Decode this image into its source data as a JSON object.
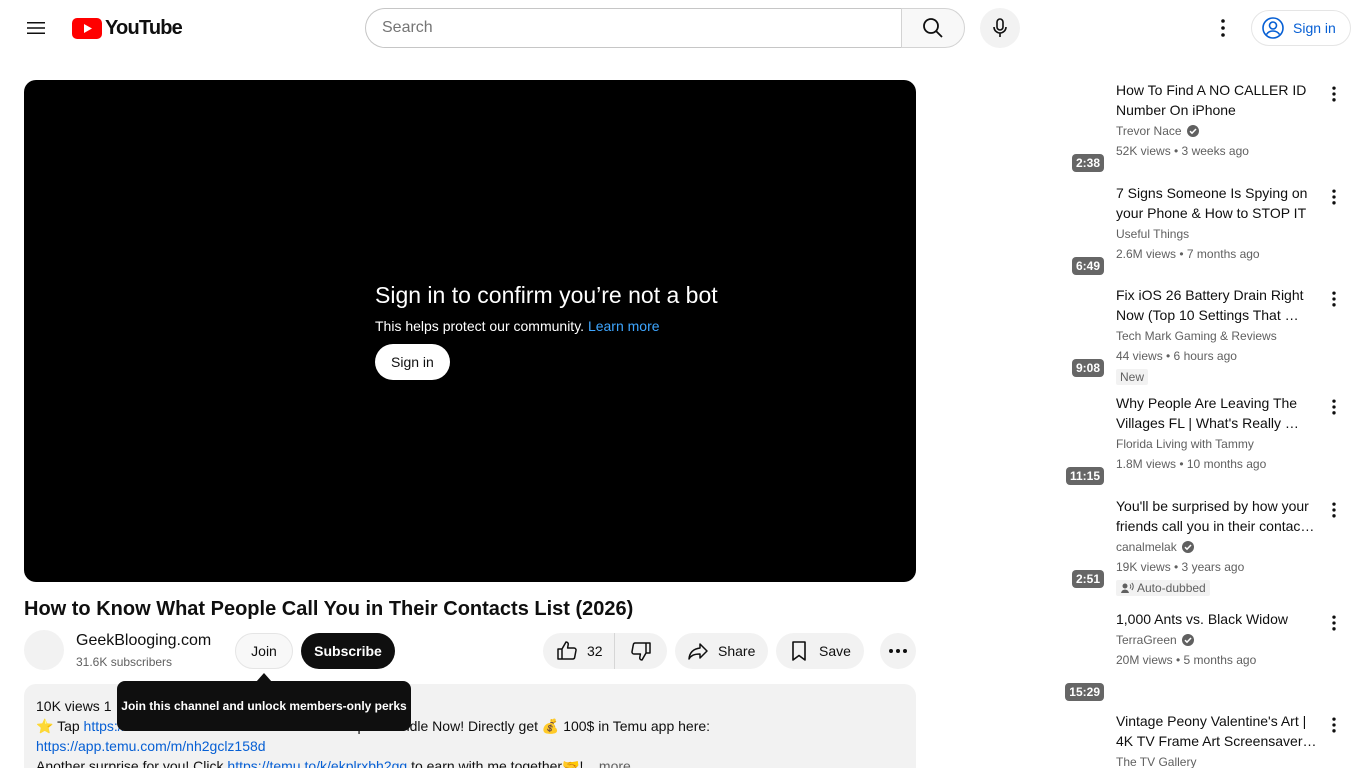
{
  "header": {
    "logo_text": "YouTube",
    "search_placeholder": "Search",
    "sign_in_label": "Sign in"
  },
  "player": {
    "bot_title": "Sign in to confirm you’re not a bot",
    "bot_subtitle": "This helps protect our community.",
    "bot_learn_more": "Learn more",
    "bot_sign_in": "Sign in"
  },
  "video": {
    "title": "How to Know What People Call You in Their Contacts List (2026)",
    "channel_name": "GeekBlooging.com",
    "subscribers": "31.6K subscribers",
    "join_label": "Join",
    "subscribe_label": "Subscribe",
    "like_count": "32",
    "share_label": "Share",
    "save_label": "Save"
  },
  "tooltip": {
    "text": "Join this channel and unlock members-only perks"
  },
  "description": {
    "line1": "10K views  1",
    "line2_prefix": "⭐ Tap",
    "line2_link": "https://",
    "line2_suffix": "pon Bundle Now! Directly get 💰 100$ in Temu app here:",
    "line3_link": "https://app.temu.com/m/nh2gclz158d",
    "line4_prefix": "Another surprise for you! Click",
    "line4_link": "https://temu.to/k/ekplrxbh2gg",
    "line4_suffix": "to earn with me together🤝!",
    "more": "...more"
  },
  "recommendations": [
    {
      "title": "How To Find A NO CALLER ID Number On iPhone",
      "channel": "Trevor Nace",
      "verified": true,
      "meta": "52K views • 3 weeks ago",
      "duration": "2:38",
      "badge": ""
    },
    {
      "title": "7 Signs Someone Is Spying on your Phone & How to STOP IT",
      "channel": "Useful Things",
      "verified": false,
      "meta": "2.6M views • 7 months ago",
      "duration": "6:49",
      "badge": ""
    },
    {
      "title": "Fix iOS 26 Battery Drain Right Now (Top 10 Settings That …",
      "channel": "Tech Mark Gaming & Reviews",
      "verified": false,
      "meta": "44 views • 6 hours ago",
      "duration": "9:08",
      "badge": "New"
    },
    {
      "title": "Why People Are Leaving The Villages FL | What's Really …",
      "channel": "Florida Living with Tammy",
      "verified": false,
      "meta": "1.8M views • 10 months ago",
      "duration": "11:15",
      "badge": ""
    },
    {
      "title": "You'll be surprised by how your friends call you in their contac…",
      "channel": "canalmelak",
      "verified": true,
      "meta": "19K views • 3 years ago",
      "duration": "2:51",
      "badge": "Auto-dubbed"
    },
    {
      "title": "1,000 Ants vs. Black Widow",
      "channel": "TerraGreen",
      "verified": true,
      "meta": "20M views • 5 months ago",
      "duration": "15:29",
      "badge": ""
    },
    {
      "title": "Vintage Peony Valentine's Art | 4K TV Frame Art Screensaver…",
      "channel": "The TV Gallery",
      "verified": false,
      "meta": "",
      "duration": "",
      "badge": ""
    }
  ]
}
